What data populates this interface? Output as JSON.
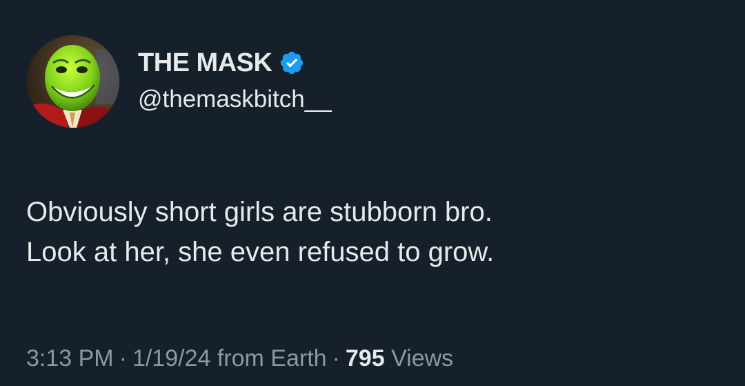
{
  "author": {
    "display_name": "THE MASK",
    "handle": "@themaskbitch__",
    "verified": true,
    "verified_color": "#1d9bf0",
    "avatar_icon": "green-mask-face-avatar"
  },
  "tweet": {
    "lines": [
      "Obviously short girls are stubborn bro.",
      "Look at her, she even refused to grow."
    ]
  },
  "meta": {
    "time": "3:13 PM",
    "separator": "·",
    "date": "1/19/24 from Earth",
    "views_count": "795",
    "views_label": "Views"
  },
  "colors": {
    "background": "#16202a",
    "text": "#e7e9ea",
    "secondary_text": "#8b98a5"
  }
}
